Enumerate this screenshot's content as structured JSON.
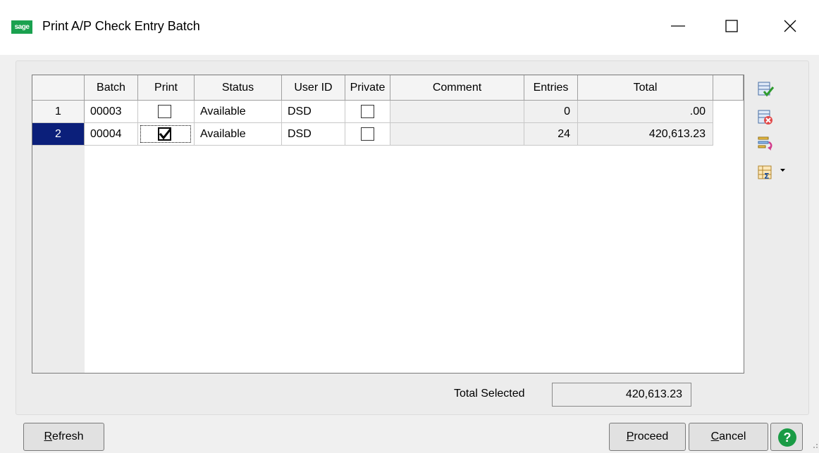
{
  "window": {
    "title": "Print A/P Check Entry Batch",
    "logo_text": "sage",
    "brand_color": "#1aa14f"
  },
  "grid": {
    "columns": [
      "Batch",
      "Print",
      "Status",
      "User ID",
      "Private",
      "Comment",
      "Entries",
      "Total"
    ],
    "rows": [
      {
        "num": "1",
        "batch": "00003",
        "print": false,
        "status": "Available",
        "user_id": "DSD",
        "private": false,
        "comment": "",
        "entries": "0",
        "total": ".00",
        "selected": false
      },
      {
        "num": "2",
        "batch": "00004",
        "print": true,
        "status": "Available",
        "user_id": "DSD",
        "private": false,
        "comment": "",
        "entries": "24",
        "total": "420,613.23",
        "selected": true
      }
    ],
    "selection_color": "#0b1f7a"
  },
  "toolbar_icons": [
    "select-all-icon",
    "clear-all-icon",
    "refresh-list-icon",
    "grid-options-icon"
  ],
  "footer": {
    "total_selected_label": "Total Selected",
    "total_selected_value": "420,613.23"
  },
  "buttons": {
    "refresh": {
      "label": "Refresh",
      "hotkey": "R"
    },
    "proceed": {
      "label": "Proceed",
      "hotkey": "P"
    },
    "cancel": {
      "label": "Cancel",
      "hotkey": "C"
    },
    "help": "?"
  }
}
